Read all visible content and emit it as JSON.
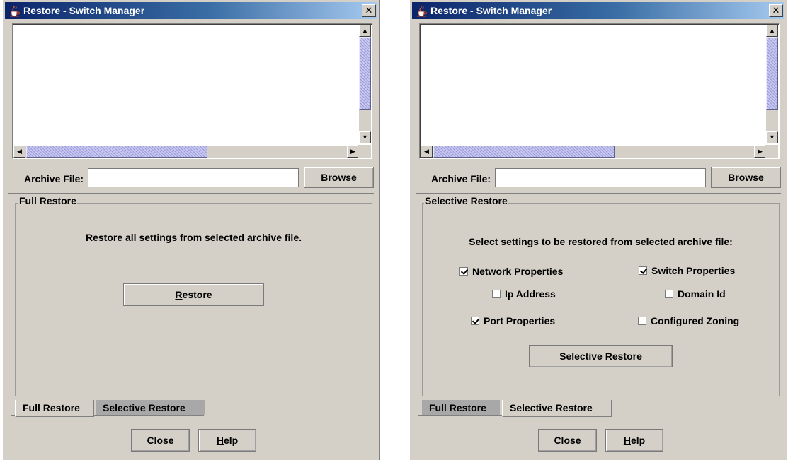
{
  "left_window": {
    "title": "Restore - Switch Manager",
    "close_glyph": "✕",
    "archive_label": "Archive File:",
    "archive_value": "",
    "browse_label": "Browse",
    "panel_legend": "Full Restore",
    "panel_text": "Restore all settings from selected archive file.",
    "restore_label": "Restore",
    "tabs": [
      "Full Restore",
      "Selective Restore"
    ],
    "active_tab": "Full Restore",
    "close_label": "Close",
    "help_label": "Help"
  },
  "right_window": {
    "title": "Restore - Switch Manager",
    "close_glyph": "✕",
    "archive_label": "Archive File:",
    "archive_value": "",
    "browse_label": "Browse",
    "panel_legend": "Selective Restore",
    "panel_text": "Select settings to be restored from selected archive file:",
    "options": [
      {
        "label": "Network Properties",
        "checked": true
      },
      {
        "label": "Switch Properties",
        "checked": true
      },
      {
        "label": "Ip Address",
        "checked": false
      },
      {
        "label": "Domain Id",
        "checked": false
      },
      {
        "label": "Port Properties",
        "checked": true
      },
      {
        "label": "Configured Zoning",
        "checked": false
      }
    ],
    "restore_label": "Selective Restore",
    "tabs": [
      "Full Restore",
      "Selective Restore"
    ],
    "active_tab": "Selective Restore",
    "close_label": "Close",
    "help_label": "Help"
  },
  "icons": {
    "app_icon": "java-cup-icon",
    "scroll_up": "▲",
    "scroll_down": "▼",
    "scroll_left": "◀",
    "scroll_right": "▶"
  },
  "colors": {
    "titlebar_start": "#0a246a",
    "titlebar_end": "#a6caf0",
    "window_bg": "#d4d0c8",
    "scroll_thumb": "#c8c8f0"
  }
}
